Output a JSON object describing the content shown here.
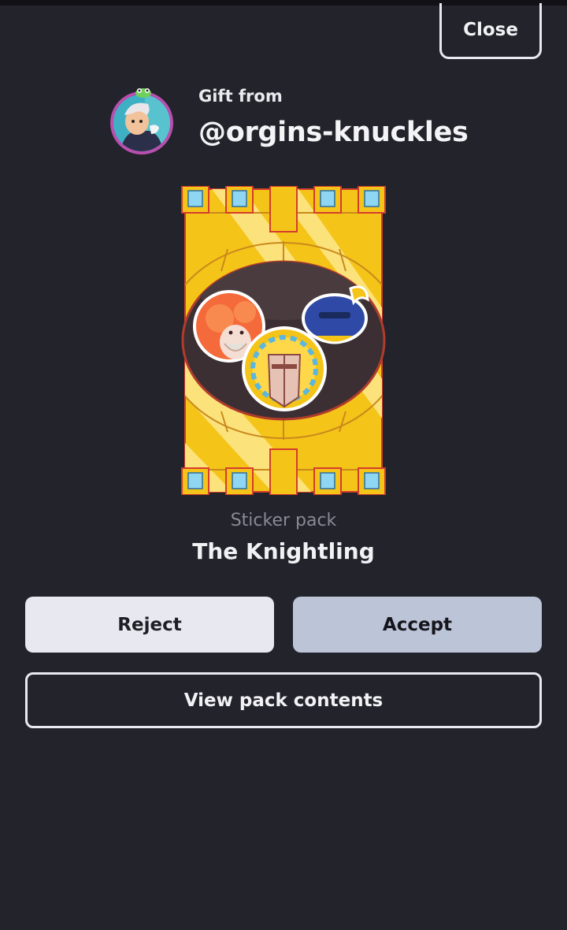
{
  "header": {
    "close_label": "Close"
  },
  "gift": {
    "from_label": "Gift from",
    "username": "@orgins-knuckles",
    "avatar_icon": "user-avatar"
  },
  "pack": {
    "type_label": "Sticker pack",
    "name": "The Knightling",
    "art_icon": "sticker-pack-art"
  },
  "actions": {
    "reject_label": "Reject",
    "accept_label": "Accept",
    "view_contents_label": "View pack contents"
  },
  "colors": {
    "background": "#23232b",
    "accept_fill": "#bcc4d8",
    "reject_fill": "#e8e8f0",
    "pack_gold": "#f5c418"
  }
}
